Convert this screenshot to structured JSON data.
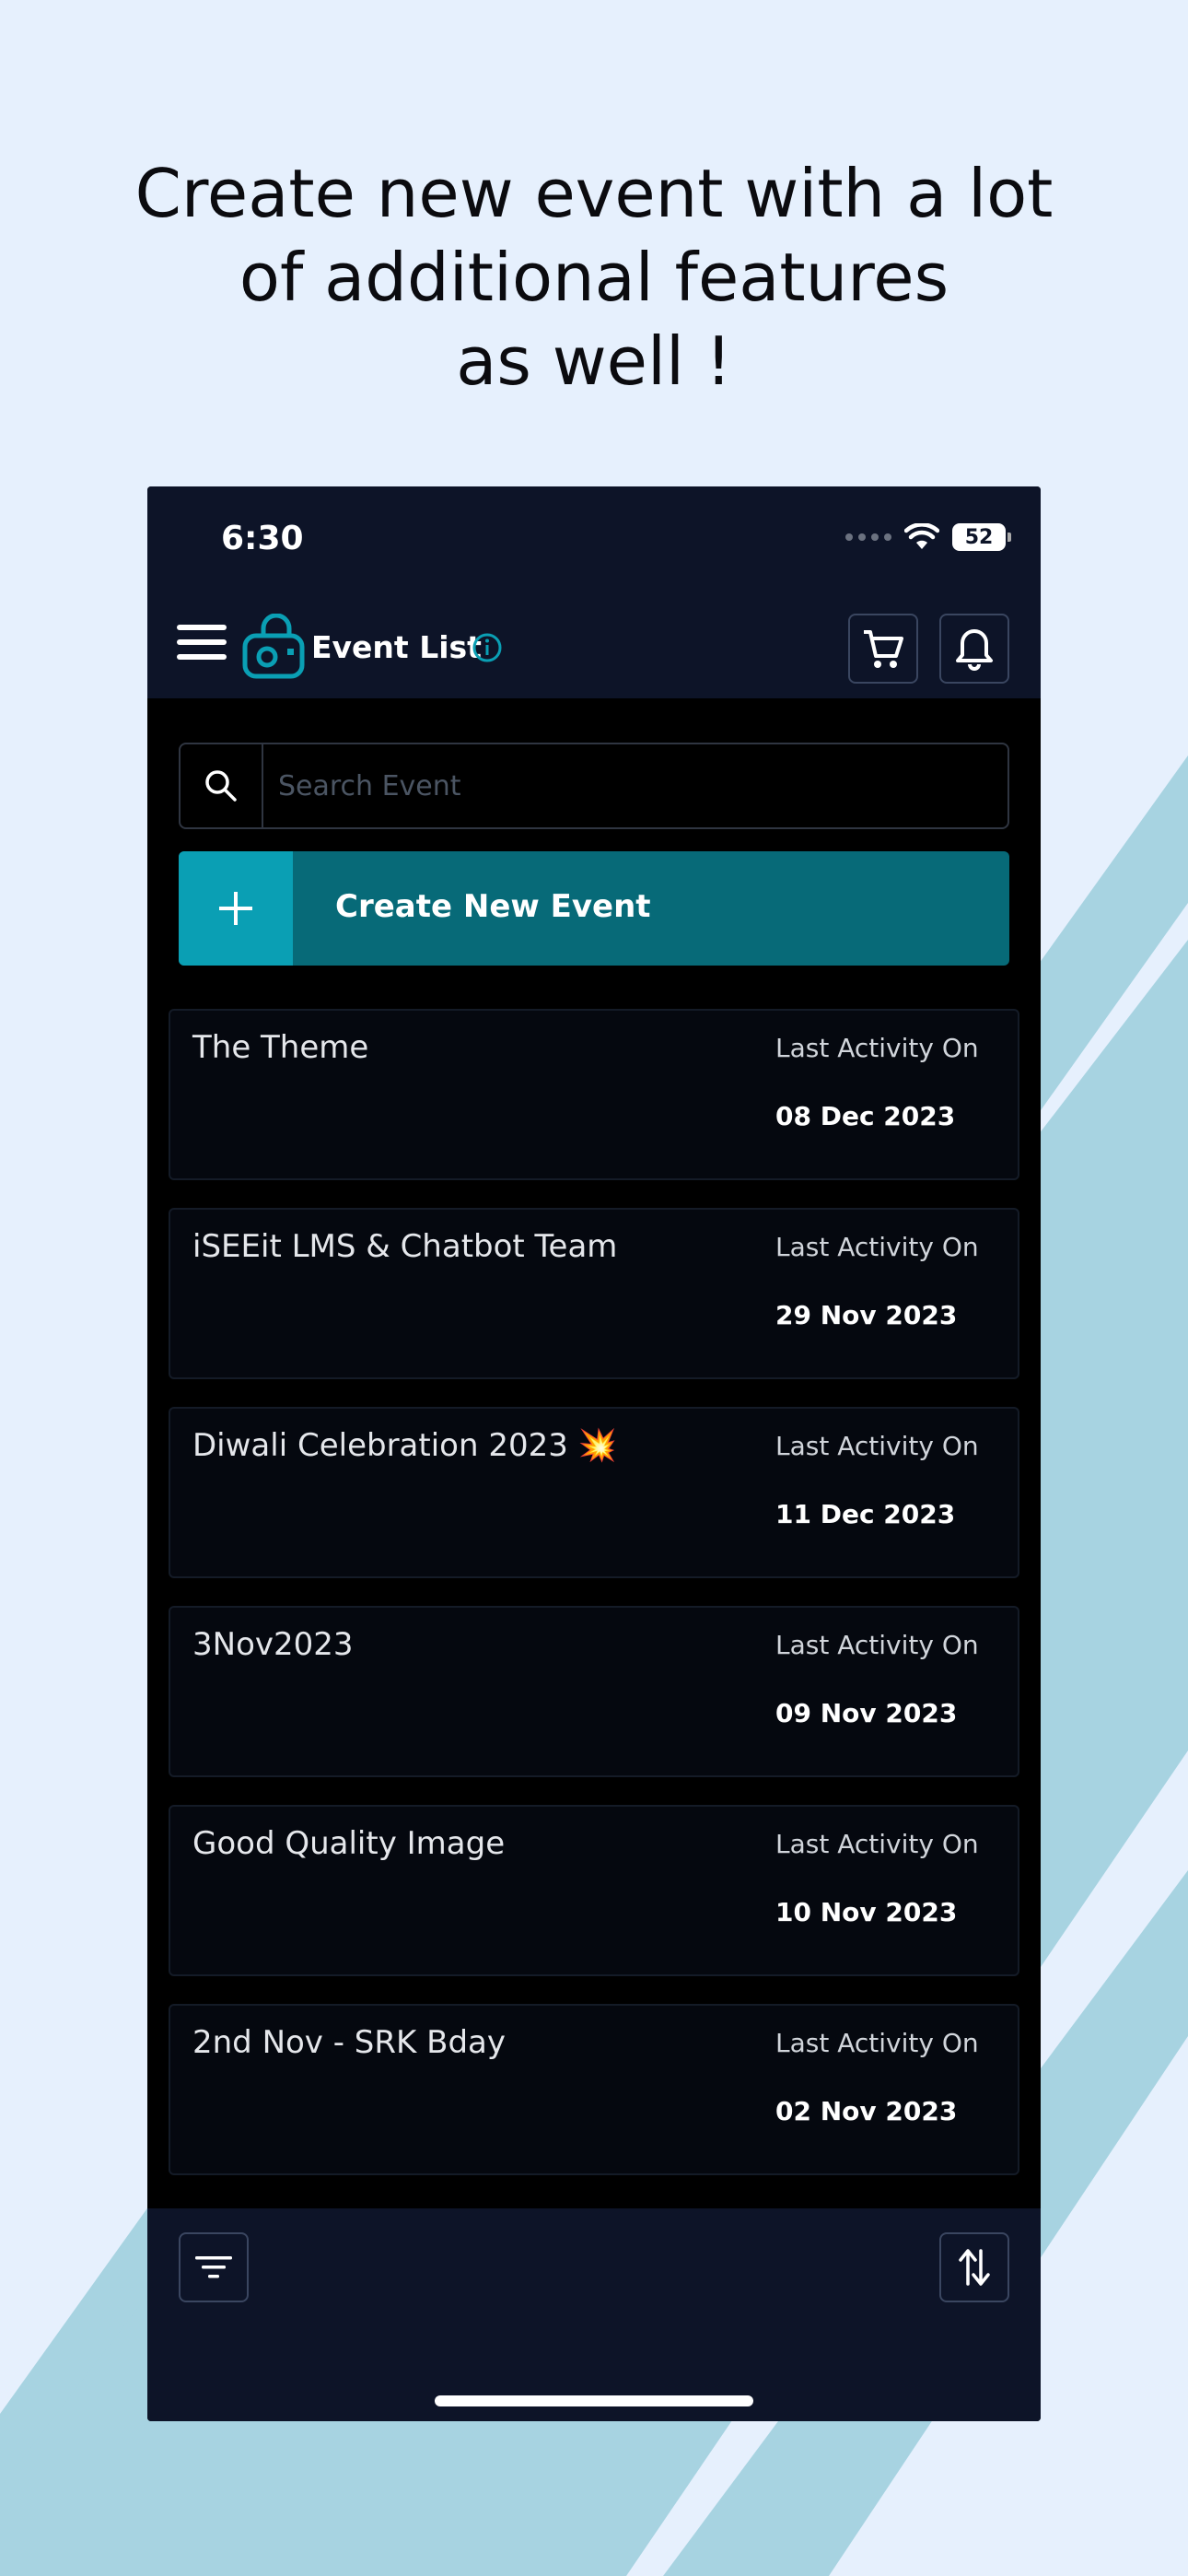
{
  "headline": {
    "line1": "Create new event with a lot",
    "line2": "of additional features",
    "line3": "as well !"
  },
  "status_bar": {
    "time": "6:30",
    "battery": "52"
  },
  "header": {
    "title": "Event List"
  },
  "search": {
    "placeholder": "Search Event"
  },
  "create_button": {
    "label": "Create New Event"
  },
  "events": [
    {
      "name": "The Theme",
      "activity_label": "Last Activity On",
      "date": "08 Dec 2023"
    },
    {
      "name": "iSEEit LMS & Chatbot Team",
      "activity_label": "Last Activity On",
      "date": "29 Nov 2023"
    },
    {
      "name": "Diwali Celebration 2023 💥",
      "activity_label": "Last Activity On",
      "date": "11 Dec 2023"
    },
    {
      "name": "3Nov2023",
      "activity_label": "Last Activity On",
      "date": "09 Nov 2023"
    },
    {
      "name": "Good Quality Image",
      "activity_label": "Last Activity On",
      "date": "10 Nov 2023"
    },
    {
      "name": "2nd Nov - SRK Bday",
      "activity_label": "Last Activity On",
      "date": "02 Nov 2023"
    }
  ],
  "colors": {
    "page_background": "#e6f0fd",
    "stripe": "#a7d3e1",
    "app_header": "#0d1428",
    "accent": "#0a9fb4",
    "create_button": "#076a78"
  },
  "icons": {
    "menu": "hamburger-menu-icon",
    "logo": "lock-camera-logo-icon",
    "info": "info-icon",
    "cart": "cart-icon",
    "bell": "bell-icon",
    "search": "search-icon",
    "plus": "plus-icon",
    "filter": "filter-icon",
    "sort": "sort-icon"
  }
}
